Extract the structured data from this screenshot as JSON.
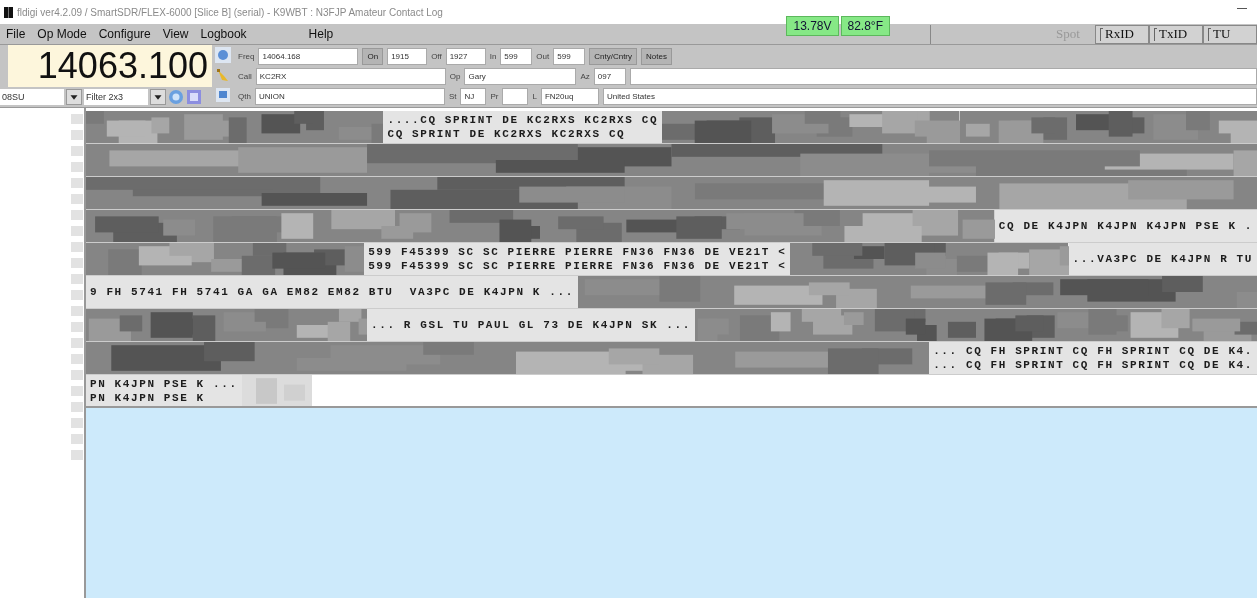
{
  "window": {
    "title": "fldigi ver4.2.09 / SmartSDR/FLEX-6000 [Slice B] (serial) - K9WBT : N3FJP Amateur Contact Log"
  },
  "menu": [
    "File",
    "Op Mode",
    "Configure",
    "View",
    "Logbook",
    "Help"
  ],
  "badges": [
    "13.78V",
    "82.8°F"
  ],
  "toggles": [
    {
      "label": "Spot",
      "disabled": true
    },
    {
      "label": "RxID",
      "disabled": false,
      "checked": false
    },
    {
      "label": "TxID",
      "disabled": false,
      "checked": false
    },
    {
      "label": "TU",
      "disabled": false,
      "checked": false
    }
  ],
  "frequency": "14063.100",
  "mode": "08SU",
  "filter": "Filter 2x3",
  "log_rows": [
    [
      {
        "kind": "field",
        "label": "Freq",
        "value": "14064.168"
      },
      {
        "kind": "button",
        "label": "On",
        "value": "1915"
      },
      {
        "kind": "field",
        "label": "Off",
        "value": "1927"
      },
      {
        "kind": "field",
        "label": "In",
        "value": "599"
      },
      {
        "kind": "field",
        "label": "Out",
        "value": "599"
      },
      {
        "kind": "action",
        "label": "Cnty/Cntry"
      },
      {
        "kind": "action",
        "label": "Notes"
      }
    ],
    [
      {
        "kind": "field",
        "label": "Call",
        "value": "KC2RX"
      },
      {
        "kind": "field",
        "label": "Op",
        "value": "Gary"
      },
      {
        "kind": "field",
        "label": "Az",
        "value": "097"
      },
      {
        "kind": "field"
      }
    ],
    [
      {
        "kind": "field",
        "label": "Qth",
        "value": "UNION"
      },
      {
        "kind": "field",
        "label": "St",
        "value": "NJ"
      },
      {
        "kind": "field",
        "label": "Pr"
      },
      {
        "kind": "field",
        "label": "L",
        "value": "FN20uq"
      },
      {
        "kind": "field",
        "value": "United States"
      }
    ]
  ],
  "receive_rows": [
    [
      {
        "kind": "noise"
      },
      {
        "kind": "text",
        "lines": [
          "....CQ SPRINT DE KC2RXS KC2RXS CQ",
          "CQ SPRINT DE KC2RXS KC2RXS CQ"
        ]
      },
      {
        "kind": "noise"
      },
      {
        "kind": "noise"
      }
    ],
    [
      {
        "kind": "noise"
      }
    ],
    [
      {
        "kind": "noise"
      }
    ],
    [
      {
        "kind": "noise"
      },
      {
        "kind": "noise"
      },
      {
        "kind": "text",
        "lines": [
          "CQ DE K4JPN K4JPN K4JPN PSE K ."
        ]
      }
    ],
    [
      {
        "kind": "noise"
      },
      {
        "kind": "text",
        "lines": [
          "599 F45399 SC SC PIERRE PIERRE FN36 FN36 DE VE21T <",
          "599 F45399 SC SC PIERRE PIERRE FN36 FN36 DE VE21T <"
        ]
      },
      {
        "kind": "noise"
      },
      {
        "kind": "text",
        "lines": [
          "...VA3PC DE K4JPN R TU"
        ]
      }
    ],
    [
      {
        "kind": "text",
        "lines": [
          "9 FH 5741 FH 5741 GA GA EM82 EM82 BTU  VA3PC DE K4JPN K ..."
        ]
      },
      {
        "kind": "noise"
      }
    ],
    [
      {
        "kind": "noise"
      },
      {
        "kind": "text",
        "lines": [
          "... R GSL TU PAUL GL 73 DE K4JPN SK ..."
        ]
      },
      {
        "kind": "noise"
      },
      {
        "kind": "noise"
      }
    ],
    [
      {
        "kind": "noise"
      },
      {
        "kind": "text",
        "lines": [
          "... CQ FH SPRINT CQ FH SPRINT CQ DE K4.",
          "... CQ FH SPRINT CQ FH SPRINT CQ DE K4."
        ]
      }
    ],
    [
      {
        "kind": "text",
        "lines": [
          "PN K4JPN PSE K ...",
          "PN K4JPN PSE K"
        ]
      },
      {
        "kind": "fade"
      },
      {
        "kind": "blank"
      }
    ]
  ]
}
